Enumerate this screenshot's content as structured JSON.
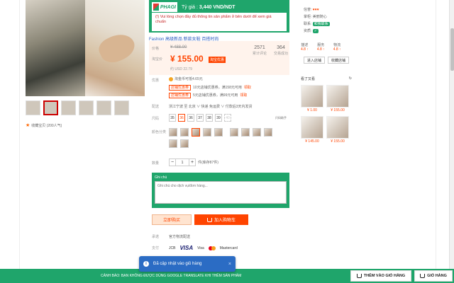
{
  "extension": {
    "logo_text": "PHAGI",
    "exchange_label": "Tỷ giá :",
    "exchange_value": "3,440 VND/NDT",
    "warning": "(!) Vui lòng chọn đầy đủ thông tin sản phẩm ở bên dưới để xem giá chuẩn"
  },
  "shop_line": "Fashion 高级新品 新款女鞋 百搭时尚",
  "price": {
    "label_price": "价格",
    "old_price": "¥ 488.00",
    "label_promo": "淘宝价",
    "new_price": "¥ 155.00",
    "tag": "淘宝优惠",
    "usd": "约 USD 22.79",
    "stat1_value": "2571",
    "stat1_label": "累计评论",
    "stat2_value": "364",
    "stat2_label": "交易成功"
  },
  "promos": {
    "label": "优惠",
    "coin_text": "淘金币可抵4.65元",
    "coupon1": "店铺优惠券",
    "coupon1_text": "10元店铺优惠券，满158元可用",
    "coupon1_get": "领取",
    "coupon2": "店铺优惠券",
    "coupon2_text": "5元店铺优惠券，满99元可用",
    "coupon2_get": "领取"
  },
  "shipping": {
    "label": "配送",
    "text": "浙江宁波 至 北京 ∨   快递 免运费 ∨   付款后3天内发货"
  },
  "size": {
    "label": "尺码",
    "options": [
      "35",
      "36",
      "36",
      "37",
      "38",
      "39",
      "40"
    ],
    "chart_link": "尺码助手"
  },
  "color_label": "颜色分类",
  "quantity": {
    "label": "数量",
    "value": "1",
    "note": "件(库存87件)"
  },
  "note": {
    "label": "Ghi chú",
    "placeholder": "Ghi chú cho dịch vụ/đơn hàng..."
  },
  "buttons": {
    "buy": "立即购买",
    "add_cart": "加入购物车"
  },
  "service": {
    "label": "承诺",
    "text": "官方物流配送"
  },
  "payment": {
    "label": "支付",
    "jcb": "JCB",
    "visa": "VISA",
    "visa2": "Visa",
    "mastercard": "Mastercard"
  },
  "favorites": "收藏宝贝 (200人气)",
  "sidebar": {
    "row1_label": "信誉:",
    "row2_label": "掌柜:",
    "row2_value": "美丽随心",
    "row3_label": "联系:",
    "row3_value": "和我联系",
    "row4_label": "资质:",
    "rate1": "描述",
    "rate1_val": "4.8 ↑",
    "rate2": "服务",
    "rate2_val": "4.8 ↑",
    "rate3": "物流",
    "rate3_val": "4.8 ↑",
    "btn_enter": "进入店铺",
    "btn_fav": "收藏店铺",
    "reco_title": "看了又看",
    "reco_prices": [
      "¥ 1.00",
      "¥ 155.00",
      "¥ 145.00",
      "¥ 155.00"
    ]
  },
  "toast": {
    "message": "Đã cập nhật vào giỏ hàng",
    "close": "×"
  },
  "bottombar": {
    "warning": "CẢNH BÁO: BẠN KHÔNG ĐƯỢC DÙNG GOOGLE TRANSLATE KHI THÊM SẢN PHẨM",
    "add_cart": "THÊM VÀO GIỎ HÀNG",
    "cart": "GIỎ HÀNG"
  }
}
